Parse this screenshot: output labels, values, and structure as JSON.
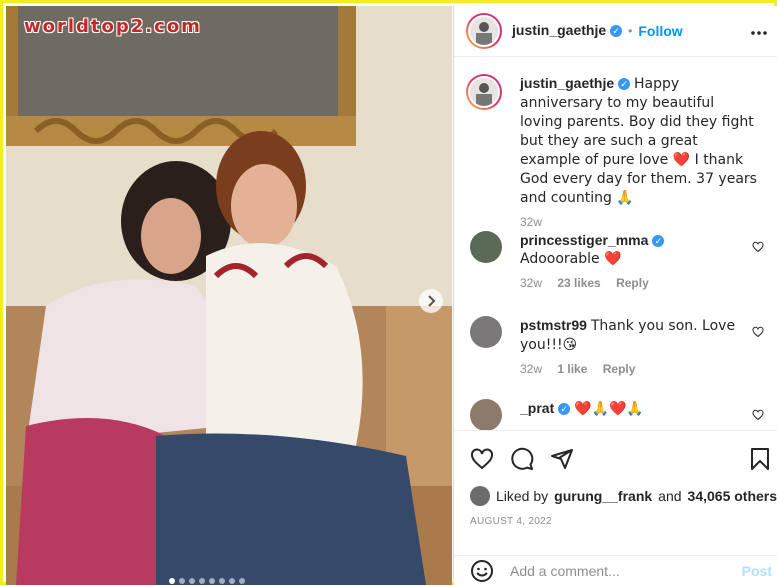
{
  "watermark": "worldtop2.com",
  "post": {
    "username": "justin_gaethje",
    "follow_label": "Follow",
    "separator": "•",
    "caption": "Happy anniversary to my beautiful loving parents. Boy did they fight but they are such a great example of pure love ❤️ I thank God every day for them. 37 years and counting 🙏",
    "caption_age": "32w",
    "liked_by_prefix": "Liked by",
    "liked_by_user": "gurung__frank",
    "liked_by_and": "and",
    "liked_by_count": "34,065 others",
    "date": "AUGUST 4, 2022",
    "carousel": {
      "count": 8,
      "active_index": 0
    }
  },
  "comments": [
    {
      "username": "princesstiger_mma",
      "verified": true,
      "text": "Adooorable ❤️",
      "age": "32w",
      "likes": "23 likes",
      "reply_label": "Reply"
    },
    {
      "username": "pstmstr99",
      "verified": false,
      "text": "Thank you son. Love you!!!😘",
      "age": "32w",
      "likes": "1 like",
      "reply_label": "Reply"
    },
    {
      "username": "_prat",
      "verified": true,
      "text": "❤️🙏❤️🙏",
      "age": "",
      "likes": "",
      "reply_label": ""
    }
  ],
  "add_comment": {
    "placeholder": "Add a comment...",
    "post_label": "Post"
  },
  "icons": {
    "more": "more-options-icon",
    "like": "heart-icon",
    "comment": "comment-icon",
    "share": "share-icon",
    "save": "bookmark-icon",
    "emoji": "emoji-icon",
    "verified": "verified-badge-icon",
    "next": "chevron-right-icon"
  },
  "colors": {
    "accent": "#0095f6",
    "verified": "#3897f0",
    "frame": "#f3ec1f",
    "watermark": "#c02a2a"
  }
}
